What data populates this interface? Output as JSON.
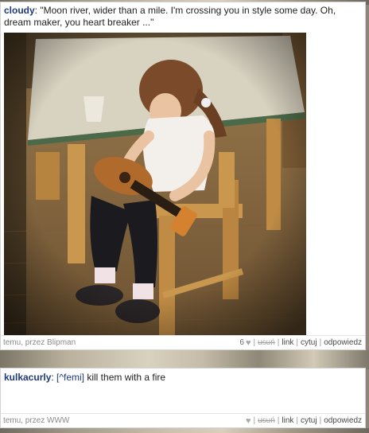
{
  "posts": [
    {
      "author": "cloudy",
      "text": ": \"Moon river, wider than a mile. I'm crossing you in style some day. Oh, dream maker, you heart breaker ...\"",
      "meta": "temu, przez Blipman",
      "likes": "6",
      "actions": [
        "usuń",
        "link",
        "cytuj",
        "odpowiedz"
      ]
    },
    {
      "author": "kulkacurly",
      "reply_to": "[^femi]",
      "text": " kill them with a fire",
      "meta": "temu, przez WWW",
      "likes": "",
      "actions": [
        "usuń",
        "link",
        "cytuj",
        "odpowiedz"
      ]
    }
  ],
  "icons": {
    "like": "heart-icon"
  }
}
